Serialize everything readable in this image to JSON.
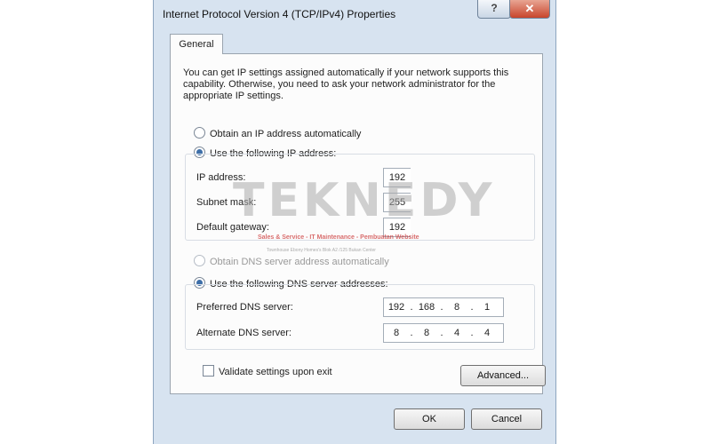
{
  "window": {
    "title": "Internet Protocol Version 4 (TCP/IPv4) Properties",
    "help_glyph": "?",
    "close_glyph": "✕"
  },
  "tabs": [
    {
      "label": "General",
      "active": true
    }
  ],
  "description": "You can get IP settings assigned automatically if your network supports this capability. Otherwise, you need to ask your network administrator for the appropriate IP settings.",
  "ip_settings": {
    "auto_label": "Obtain an IP address automatically",
    "manual_label": "Use the following IP address:",
    "selected": "manual",
    "fields": [
      {
        "label": "IP address:",
        "value": "192"
      },
      {
        "label": "Subnet mask:",
        "value": "255"
      },
      {
        "label": "Default gateway:",
        "value": "192"
      }
    ]
  },
  "dns_settings": {
    "auto_label": "Obtain DNS server address automatically",
    "manual_label": "Use the following DNS server addresses:",
    "selected": "manual",
    "preferred": {
      "label": "Preferred DNS server:",
      "octets": [
        "192",
        "168",
        "8",
        "1"
      ]
    },
    "alternate": {
      "label": "Alternate DNS server:",
      "octets": [
        "8",
        "8",
        "4",
        "4"
      ]
    }
  },
  "validate_label": "Validate settings upon exit",
  "validate_checked": false,
  "buttons": {
    "advanced": "Advanced...",
    "ok": "OK",
    "cancel": "Cancel"
  },
  "watermark": {
    "brand": "TEKNEDY",
    "tagline": "Sales & Service - IT Maintenance - Pembuatan Website",
    "address": "Townhouse Ebony Homes's Blok A2 /125 Bukan Center"
  },
  "colors": {
    "accent": "#3d6ea8",
    "window_bg": "#d7e3f0",
    "close_button": "#c8452c"
  }
}
